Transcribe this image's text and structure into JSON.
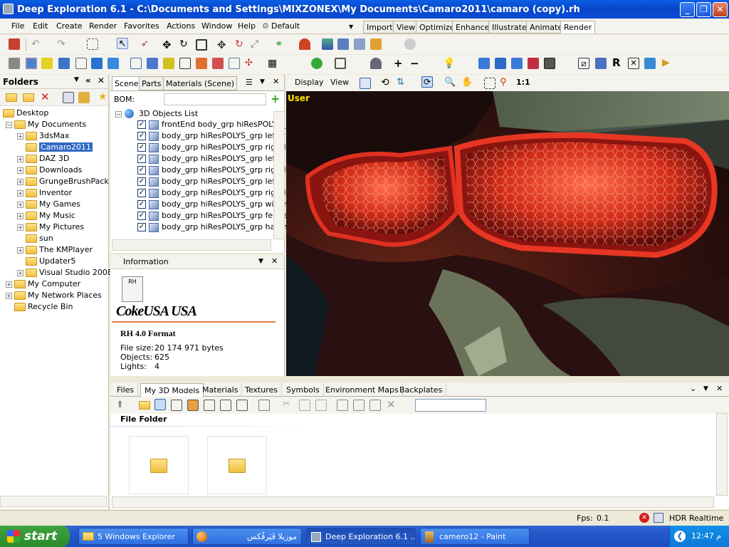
{
  "window": {
    "title": "Deep Exploration 6.1 - C:\\Documents and Settings\\MIXZONEX\\My Documents\\Camaro2011\\camaro (copy).rh"
  },
  "menu": {
    "items": [
      "File",
      "Edit",
      "Create",
      "Render",
      "Favorites",
      "Actions",
      "Window",
      "Help"
    ],
    "workspace": "Default",
    "mode_tabs": [
      "Import",
      "View",
      "Optimize",
      "Enhance",
      "Illustrate",
      "Animate",
      "Render"
    ],
    "active_mode": "Render"
  },
  "folders": {
    "title": "Folders",
    "tree": [
      {
        "label": "Desktop",
        "level": 0
      },
      {
        "label": "My Documents",
        "level": 1
      },
      {
        "label": "3dsMax",
        "level": 2
      },
      {
        "label": "Camaro2011",
        "level": 2,
        "selected": true
      },
      {
        "label": "DAZ 3D",
        "level": 2
      },
      {
        "label": "Downloads",
        "level": 2
      },
      {
        "label": "GrungeBrushPack",
        "level": 2
      },
      {
        "label": "Inventor",
        "level": 2
      },
      {
        "label": "My Games",
        "level": 2
      },
      {
        "label": "My Music",
        "level": 2
      },
      {
        "label": "My Pictures",
        "level": 2
      },
      {
        "label": "sun",
        "level": 2
      },
      {
        "label": "The KMPlayer",
        "level": 2
      },
      {
        "label": "Updater5",
        "level": 2
      },
      {
        "label": "Visual Studio 2008",
        "level": 2
      },
      {
        "label": "My Computer",
        "level": 1
      },
      {
        "label": "My Network Places",
        "level": 1
      },
      {
        "label": "Recycle Bin",
        "level": 1
      }
    ]
  },
  "scene_panel": {
    "tabs": [
      "Scene",
      "Parts",
      "Materials (Scene)"
    ],
    "bom_label": "BOM:",
    "root": "3D Objects List",
    "objects": [
      "frontEnd body_grp hiResPOLYS_",
      "body_grp hiResPOLYS_grp leftFr",
      "body_grp hiResPOLYS_grp rightI",
      "body_grp hiResPOLYS_grp leftD",
      "body_grp hiResPOLYS_grp rightI",
      "body_grp hiResPOLYS_grp leftR",
      "body_grp hiResPOLYS_grp rightI",
      "body_grp hiResPOLYS_grp wiper",
      "body_grp hiResPOLYS_grp fende",
      "body_grp hiResPOLYS_grp hatch"
    ]
  },
  "info_panel": {
    "title": "Information",
    "icon_label": "RH",
    "brand": "CokeUSA  USA",
    "format": "RH 4.0 Format",
    "file_size_label": "File size:",
    "file_size": "20 174 971 bytes",
    "objects_label": "Objects:",
    "objects": "625",
    "lights_label": "Lights:",
    "lights": "4"
  },
  "viewport": {
    "toolbar_display": "Display",
    "toolbar_view": "View",
    "zoom_ratio": "1:1",
    "camera_label": "User"
  },
  "bottom_panel": {
    "tabs": [
      "Files",
      "My 3D Models",
      "Materials",
      "Textures",
      "Symbols",
      "Environment Maps",
      "Backplates"
    ],
    "active_tab": "My 3D Models",
    "section": "File Folder",
    "search_value": ""
  },
  "status": {
    "fps_label": "Fps:",
    "fps": "0.1",
    "render_mode": "HDR Realtime"
  },
  "taskbar": {
    "start": "start",
    "tasks": [
      "5 Windows Explorer",
      "موزيلا فَيَرفُكس",
      "Deep Exploration 6.1 ...",
      "camero12 - Paint"
    ],
    "clock": "12:47 م"
  },
  "colors": {
    "title_blue": "#0746c8",
    "taillight_red": "#c0281c",
    "start_green": "#2a8a2a"
  }
}
